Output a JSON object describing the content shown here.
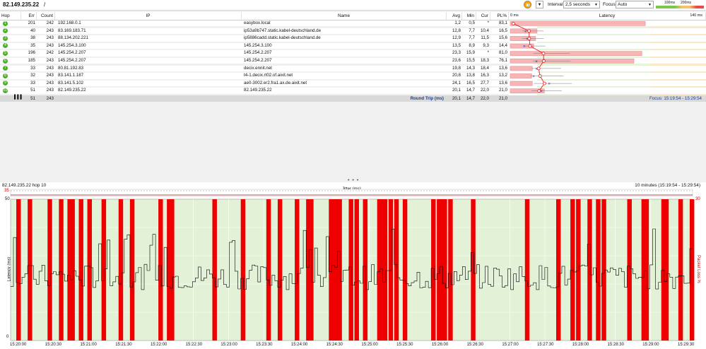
{
  "toolbar": {
    "target": "82.149.235.22",
    "slash": "/",
    "interval_label": "Interval",
    "interval_value": "2,5 seconds",
    "focus_label": "Focus",
    "focus_value": "Auto",
    "legend_100": "100ms",
    "legend_200": "200ms"
  },
  "table": {
    "headers": {
      "hop": "Hop",
      "err": "Err",
      "count": "Count",
      "ip": "IP",
      "name": "Name",
      "avg": "Avg",
      "min": "Min",
      "cur": "Cur",
      "pl": "PL%",
      "latency": "Latency"
    },
    "latency_scale_start": "0 ms",
    "latency_scale_end": "140 ms",
    "rows": [
      {
        "hop": "1",
        "err": "201",
        "count": "242",
        "ip": "192.168.0.1",
        "name": "easybox.local",
        "avg": "1,2",
        "min": "0,5",
        "cur": "*",
        "pl": "83,1"
      },
      {
        "hop": "2",
        "err": "40",
        "count": "243",
        "ip": "83.169.183.71",
        "name": "ip53a9b747.static.kabel-deutschland.de",
        "avg": "12,8",
        "min": "7,7",
        "cur": "10,4",
        "pl": "16,5"
      },
      {
        "hop": "3",
        "err": "38",
        "count": "243",
        "ip": "88.134.202.221",
        "name": "ip5886cadd.static.kabel-deutschland.de",
        "avg": "12,9",
        "min": "7,7",
        "cur": "11,5",
        "pl": "15,6"
      },
      {
        "hop": "4",
        "err": "35",
        "count": "243",
        "ip": "145.254.3.100",
        "name": "145.254.3.100",
        "avg": "13,5",
        "min": "8,9",
        "cur": "9,3",
        "pl": "14,4"
      },
      {
        "hop": "5",
        "err": "196",
        "count": "242",
        "ip": "145.254.2.207",
        "name": "145.254.2.207",
        "avg": "23,3",
        "min": "15,9",
        "cur": "*",
        "pl": "81,0"
      },
      {
        "hop": "6",
        "err": "185",
        "count": "243",
        "ip": "145.254.2.207",
        "name": "145.254.2.207",
        "avg": "23,6",
        "min": "15,5",
        "cur": "18,3",
        "pl": "76,1"
      },
      {
        "hop": "7",
        "err": "33",
        "count": "243",
        "ip": "80.81.192.83",
        "name": "decix.ennit.net",
        "avg": "19,8",
        "min": "14,3",
        "cur": "18,4",
        "pl": "13,6"
      },
      {
        "hop": "8",
        "err": "32",
        "count": "243",
        "ip": "83.141.1.187",
        "name": "t4-1.decix.rt02.of.aixit.net",
        "avg": "20,8",
        "min": "13,8",
        "cur": "16,3",
        "pl": "13,2"
      },
      {
        "hop": "9",
        "err": "33",
        "count": "243",
        "ip": "83.141.5.102",
        "name": "ae0-3002.er2.fra1.ax.de.aixit.net",
        "avg": "24,1",
        "min": "16,5",
        "cur": "27,7",
        "pl": "13,6"
      },
      {
        "hop": "10",
        "err": "51",
        "count": "243",
        "ip": "82.149.235.22",
        "name": "82.149.235.22",
        "avg": "20,1",
        "min": "14,7",
        "cur": "22,0",
        "pl": "21,0"
      }
    ],
    "summary": {
      "err": "51",
      "count": "243",
      "label": "Round Trip (ms)",
      "avg": "20,1",
      "min": "14,7",
      "cur": "22,0",
      "pl": "21,0",
      "focus": "Focus: 15:19:54 - 15:29:54"
    }
  },
  "divider": "• • •",
  "graph": {
    "title": "82.149.235.22 hop 10",
    "range": "10 minutes (15:19:54 - 15:29:54)",
    "jitter_label": "Jitter (ms)",
    "jitter_max": "35",
    "y_left_top": "50",
    "y_left_bottom": "0",
    "y_right_top": "30",
    "y_left_title": "Latency (ms)",
    "y_right_title": "Packet Loss %",
    "x_ticks": [
      "15:20:00",
      "15:20:30",
      "15:21:00",
      "15:21:30",
      "15:22:00",
      "15:22:30",
      "15:23:00",
      "15:23:30",
      "15:24:00",
      "15:24:30",
      "15:25:00",
      "15:25:30",
      "15:26:00",
      "15:26:30",
      "15:27:00",
      "15:27:30",
      "15:28:00",
      "15:28:30",
      "15:29:00",
      "15:29:30"
    ],
    "colors": {
      "bg_green": "#e3f2d6",
      "loss_red": "#ee0000",
      "line": "#000000"
    }
  }
}
